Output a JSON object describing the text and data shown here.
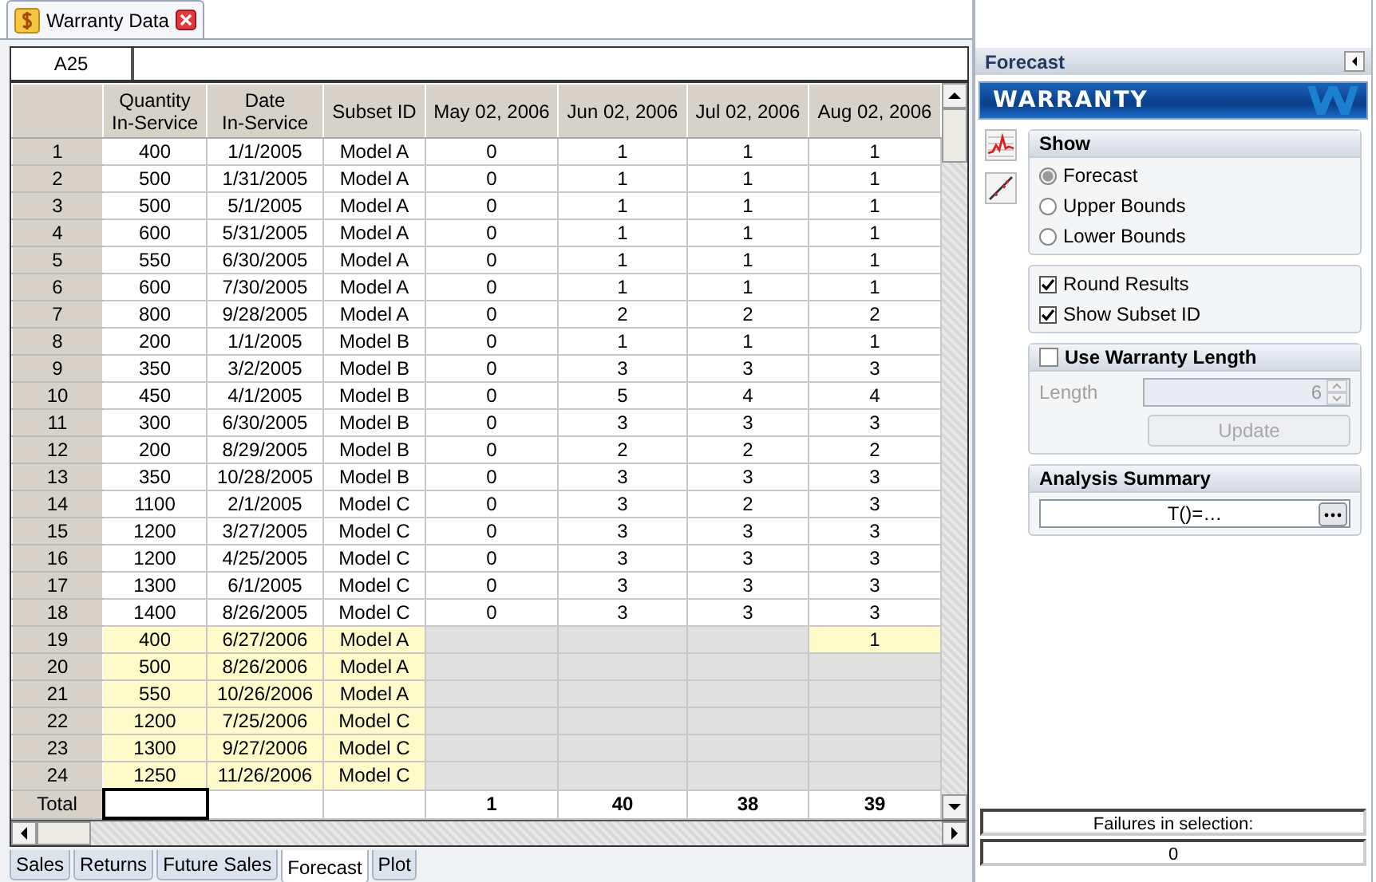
{
  "document_tab": {
    "title": "Warranty Data"
  },
  "cell_reference": "A25",
  "table": {
    "columns": [
      "Quantity\nIn-Service",
      "Date\nIn-Service",
      "Subset ID",
      "May 02, 2006",
      "Jun 02, 2006",
      "Jul 02, 2006",
      "Aug 02, 2006"
    ],
    "rows": [
      {
        "number": "1",
        "kind": "past",
        "quantity": "400",
        "date": "1/1/2005",
        "subset": "Model A",
        "values": [
          "0",
          "1",
          "1",
          "1"
        ]
      },
      {
        "number": "2",
        "kind": "past",
        "quantity": "500",
        "date": "1/31/2005",
        "subset": "Model A",
        "values": [
          "0",
          "1",
          "1",
          "1"
        ]
      },
      {
        "number": "3",
        "kind": "past",
        "quantity": "500",
        "date": "5/1/2005",
        "subset": "Model A",
        "values": [
          "0",
          "1",
          "1",
          "1"
        ]
      },
      {
        "number": "4",
        "kind": "past",
        "quantity": "600",
        "date": "5/31/2005",
        "subset": "Model A",
        "values": [
          "0",
          "1",
          "1",
          "1"
        ]
      },
      {
        "number": "5",
        "kind": "past",
        "quantity": "550",
        "date": "6/30/2005",
        "subset": "Model A",
        "values": [
          "0",
          "1",
          "1",
          "1"
        ]
      },
      {
        "number": "6",
        "kind": "past",
        "quantity": "600",
        "date": "7/30/2005",
        "subset": "Model A",
        "values": [
          "0",
          "1",
          "1",
          "1"
        ]
      },
      {
        "number": "7",
        "kind": "past",
        "quantity": "800",
        "date": "9/28/2005",
        "subset": "Model A",
        "values": [
          "0",
          "2",
          "2",
          "2"
        ]
      },
      {
        "number": "8",
        "kind": "past",
        "quantity": "200",
        "date": "1/1/2005",
        "subset": "Model B",
        "values": [
          "0",
          "1",
          "1",
          "1"
        ]
      },
      {
        "number": "9",
        "kind": "past",
        "quantity": "350",
        "date": "3/2/2005",
        "subset": "Model B",
        "values": [
          "0",
          "3",
          "3",
          "3"
        ]
      },
      {
        "number": "10",
        "kind": "past",
        "quantity": "450",
        "date": "4/1/2005",
        "subset": "Model B",
        "values": [
          "0",
          "5",
          "4",
          "4"
        ]
      },
      {
        "number": "11",
        "kind": "past",
        "quantity": "300",
        "date": "6/30/2005",
        "subset": "Model B",
        "values": [
          "0",
          "3",
          "3",
          "3"
        ]
      },
      {
        "number": "12",
        "kind": "past",
        "quantity": "200",
        "date": "8/29/2005",
        "subset": "Model B",
        "values": [
          "0",
          "2",
          "2",
          "2"
        ]
      },
      {
        "number": "13",
        "kind": "past",
        "quantity": "350",
        "date": "10/28/2005",
        "subset": "Model B",
        "values": [
          "0",
          "3",
          "3",
          "3"
        ]
      },
      {
        "number": "14",
        "kind": "past",
        "quantity": "1100",
        "date": "2/1/2005",
        "subset": "Model C",
        "values": [
          "0",
          "3",
          "2",
          "3"
        ]
      },
      {
        "number": "15",
        "kind": "past",
        "quantity": "1200",
        "date": "3/27/2005",
        "subset": "Model C",
        "values": [
          "0",
          "3",
          "3",
          "3"
        ]
      },
      {
        "number": "16",
        "kind": "past",
        "quantity": "1200",
        "date": "4/25/2005",
        "subset": "Model C",
        "values": [
          "0",
          "3",
          "3",
          "3"
        ]
      },
      {
        "number": "17",
        "kind": "past",
        "quantity": "1300",
        "date": "6/1/2005",
        "subset": "Model C",
        "values": [
          "0",
          "3",
          "3",
          "3"
        ]
      },
      {
        "number": "18",
        "kind": "past",
        "quantity": "1400",
        "date": "8/26/2005",
        "subset": "Model C",
        "values": [
          "0",
          "3",
          "3",
          "3"
        ]
      },
      {
        "number": "19",
        "kind": "future",
        "quantity": "400",
        "date": "6/27/2006",
        "subset": "Model A",
        "cells": [
          {
            "kind": "blank"
          },
          {
            "kind": "blank"
          },
          {
            "kind": "blank"
          },
          {
            "kind": "count",
            "text": "1"
          }
        ]
      },
      {
        "number": "20",
        "kind": "future",
        "quantity": "500",
        "date": "8/26/2006",
        "subset": "Model A",
        "cells": [
          {
            "kind": "blank"
          },
          {
            "kind": "blank"
          },
          {
            "kind": "blank"
          },
          {
            "kind": "blank"
          }
        ]
      },
      {
        "number": "21",
        "kind": "future",
        "quantity": "550",
        "date": "10/26/2006",
        "subset": "Model A",
        "cells": [
          {
            "kind": "blank"
          },
          {
            "kind": "blank"
          },
          {
            "kind": "blank"
          },
          {
            "kind": "blank"
          }
        ]
      },
      {
        "number": "22",
        "kind": "future",
        "quantity": "1200",
        "date": "7/25/2006",
        "subset": "Model C",
        "cells": [
          {
            "kind": "blank"
          },
          {
            "kind": "blank"
          },
          {
            "kind": "blank"
          },
          {
            "kind": "blank"
          }
        ]
      },
      {
        "number": "23",
        "kind": "future",
        "quantity": "1300",
        "date": "9/27/2006",
        "subset": "Model C",
        "cells": [
          {
            "kind": "blank"
          },
          {
            "kind": "blank"
          },
          {
            "kind": "blank"
          },
          {
            "kind": "blank"
          }
        ]
      },
      {
        "number": "24",
        "kind": "future",
        "quantity": "1250",
        "date": "11/26/2006",
        "subset": "Model C",
        "cells": [
          {
            "kind": "blank"
          },
          {
            "kind": "blank"
          },
          {
            "kind": "blank"
          },
          {
            "kind": "blank"
          }
        ]
      }
    ],
    "total": {
      "label": "Total",
      "values": [
        "1",
        "40",
        "38",
        "39"
      ]
    }
  },
  "sheet_tabs": [
    {
      "label": "Sales",
      "selected": false
    },
    {
      "label": "Returns",
      "selected": false
    },
    {
      "label": "Future Sales",
      "selected": false
    },
    {
      "label": "Forecast",
      "selected": true
    },
    {
      "label": "Plot",
      "selected": false
    }
  ],
  "panel": {
    "title": "Forecast",
    "banner": "WARRANTY",
    "show": {
      "title": "Show",
      "options": [
        {
          "label": "Forecast",
          "selected": true
        },
        {
          "label": "Upper Bounds",
          "selected": false
        },
        {
          "label": "Lower Bounds",
          "selected": false
        }
      ]
    },
    "options": [
      {
        "label": "Round Results",
        "checked": true
      },
      {
        "label": "Show Subset ID",
        "checked": true
      }
    ],
    "warranty_length": {
      "label": "Use Warranty Length",
      "checked": false,
      "length_label": "Length",
      "length_value": "6",
      "update_button": "Update"
    },
    "analysis_summary": {
      "title": "Analysis Summary",
      "value": "T()=…"
    }
  },
  "footer": {
    "label": "Failures in selection:",
    "value": "0"
  }
}
